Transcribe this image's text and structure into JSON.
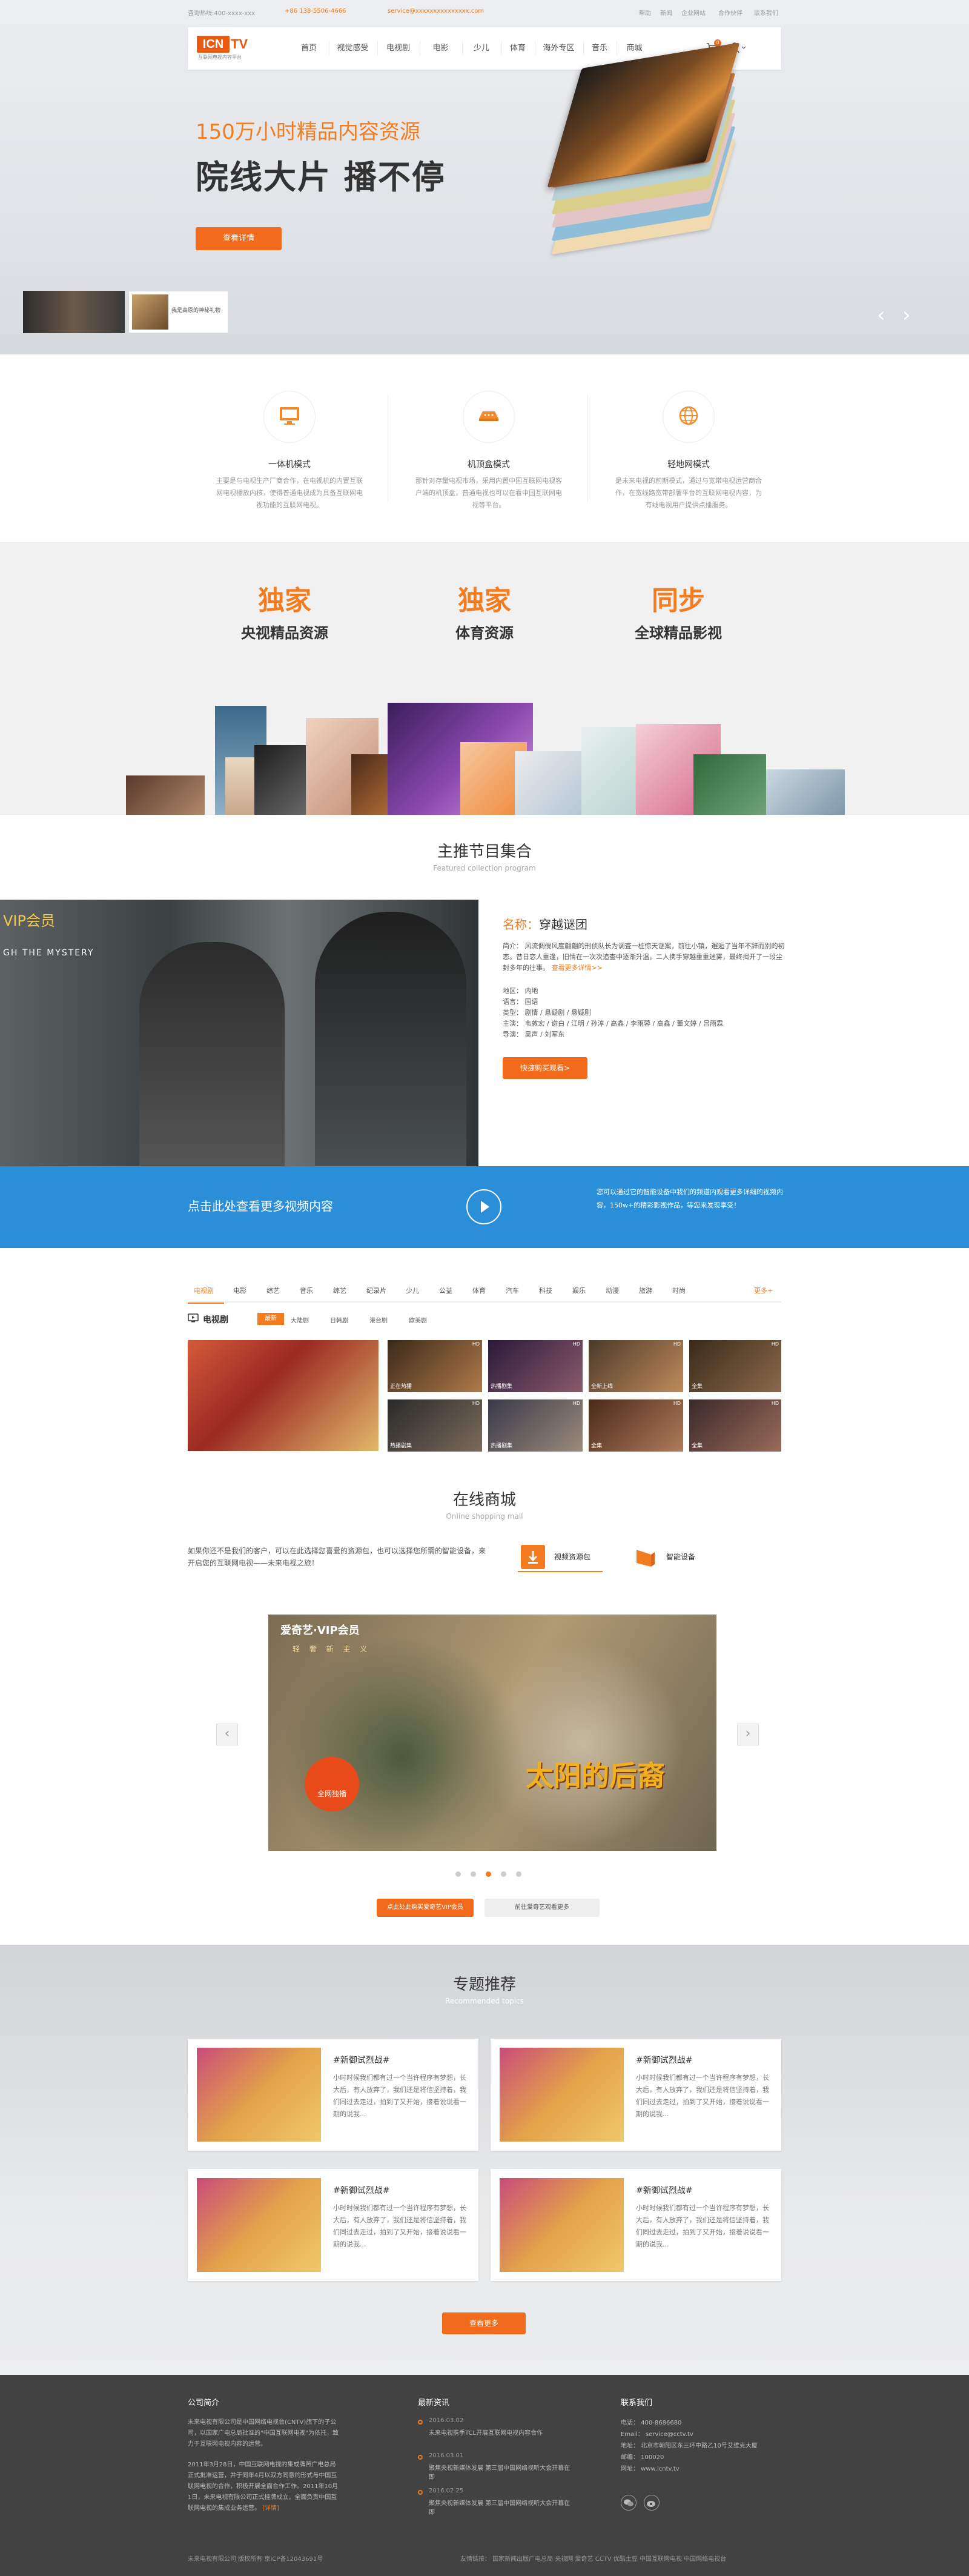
{
  "topbar": {
    "left": "咨询热线:400-xxxx-xxx",
    "phone": "+86 138-5506-4666",
    "email": "service@xxxxxxxxxxxxxxx.com",
    "links": [
      "帮助",
      "新闻",
      "企业网站",
      "合作伙伴",
      "联系我们"
    ]
  },
  "logo": {
    "mark": "ICN",
    "tv": "TV",
    "tagline": "互联网电视内容平台"
  },
  "nav": [
    "首页",
    "视觉感受",
    "电视剧",
    "电影",
    "少儿",
    "体育",
    "海外专区",
    "音乐",
    "商城"
  ],
  "cart_count": "0",
  "hero": {
    "subtitle_num": "150万",
    "subtitle": "小时精品内容资源",
    "title": "院线大片 播不停",
    "cta": "查看详情",
    "thumb_caption": "我是高原的神秘礼物"
  },
  "features": [
    {
      "icon": "monitor-icon",
      "title": "一体机模式",
      "desc": "主要是与电视生产厂商合作，在电视机的内置互联网电视播放内核，使得普通电视成为具备互联网电视功能的互联网电视。"
    },
    {
      "icon": "set-top-box-icon",
      "title": "机顶盒模式",
      "desc": "那针对存量电视市场，采用内置中国互联网电视客户端的机顶盒，普通电视也可以在看中国互联网电视等平台。"
    },
    {
      "icon": "globe-icon",
      "title": "轻地网模式",
      "desc": "是未来电视的前期模式，通过与宽带电视运营商合作，在宽线路宽带部署平台的互联网电视内容，为有线电视用户提供点播服务。"
    }
  ],
  "exclusive": [
    {
      "big": "独家",
      "small": "央视精品资源"
    },
    {
      "big": "独家",
      "small": "体育资源"
    },
    {
      "big": "同步",
      "small": "全球精品影视"
    }
  ],
  "featured": {
    "title": "主推节目集合",
    "subtitle": "Featured collection program",
    "vip": "VIP会员",
    "poster_en": "GH THE MYSTERY",
    "name_label": "名称：",
    "name": "穿越谜团",
    "intro": "简介：  风流倜傥风度翩翩的刑侦队长为调查一桩惊天谜案，前往小镇，邂逅了当年不辞而别的初恋。昔日恋人重逢，旧情在一次次追查中逐渐升温，二人携手穿越重重迷雾，最终揭开了一段尘封多年的往事。",
    "more": "查看更多详情>>",
    "meta": [
      "地区：  内地",
      "语言：  国语",
      "类型：  剧情 / 悬疑剧 / 悬疑剧",
      "主演：  韦敦宏 / 谢白 / 江明 / 孙淳 / 高鑫 / 李雨蓉 / 高鑫 / 董文婷 / 吕雨霖",
      "导演：  吴声 / 刘军东"
    ],
    "button": "快捷购买观看>"
  },
  "blue": {
    "left": "点击此处查看更多视频内容",
    "right": "您可以通过它的智能设备中我们的频道内观看更多详细的视频内容，150w+的精彩影视作品，等您来发现享受！"
  },
  "categories": [
    "电视剧",
    "电影",
    "综艺",
    "音乐",
    "综艺",
    "纪录片",
    "少儿",
    "公益",
    "体育",
    "汽车",
    "科技",
    "娱乐",
    "动漫",
    "旅游",
    "时尚",
    "更多+"
  ],
  "tv": {
    "label": "电视剧",
    "tabs": [
      "最新",
      "大陆剧",
      "日韩剧",
      "港台剧",
      "欧美剧"
    ]
  },
  "tv_grid": [
    {
      "caption": "",
      "tag": ""
    },
    {
      "caption": "正在热播",
      "tag": "HD"
    },
    {
      "caption": "热播剧集",
      "tag": "HD"
    },
    {
      "caption": "全新上线",
      "tag": "HD"
    },
    {
      "caption": "全集",
      "tag": "HD"
    },
    {
      "caption": "热播剧集",
      "tag": "HD"
    },
    {
      "caption": "热播剧集",
      "tag": "HD"
    },
    {
      "caption": "全集",
      "tag": "HD"
    },
    {
      "caption": "全集",
      "tag": "HD"
    }
  ],
  "store": {
    "title": "在线商城",
    "subtitle": "Online shopping mall",
    "text": "如果你还不是我们的客户，可以在此选择您喜爱的资源包，也可以选择您所需的智能设备，来开启您的互联网电视——未来电视之旅！",
    "tab1": "视频资源包",
    "tab2": "智能设备",
    "banner_brand": "爱奇艺·VIP会员",
    "banner_sub": "轻 奢 新 主 义",
    "banner_title": "太阳的后裔",
    "banner_badge": "全网独播",
    "btn1": "点此处此购买爱奇艺VIP会员",
    "btn2": "前往爱奇艺观看更多"
  },
  "topics": {
    "title": "专题推荐",
    "subtitle": "Recommended topics",
    "cards": [
      {
        "title": "#新御试烈战#",
        "text": "小时时候我们都有过一个当许程序有梦想，长大后，有人放弃了，我们还是将信坚持着，我们同过去走过，拍到了又开始，接着说说看一期的说我..."
      },
      {
        "title": "#新御试烈战#",
        "text": "小时时候我们都有过一个当许程序有梦想，长大后，有人放弃了，我们还是将信坚持着，我们同过去走过，拍到了又开始，接着说说看一期的说我..."
      },
      {
        "title": "#新御试烈战#",
        "text": "小时时候我们都有过一个当许程序有梦想，长大后，有人放弃了，我们还是将信坚持着，我们同过去走过，拍到了又开始，接着说说看一期的说我..."
      },
      {
        "title": "#新御试烈战#",
        "text": "小时时候我们都有过一个当许程序有梦想，长大后，有人放弃了，我们还是将信坚持着，我们同过去走过，拍到了又开始，接着说说看一期的说我..."
      }
    ],
    "more": "查看更多"
  },
  "footer": {
    "about_title": "公司简介",
    "about1": "未来电视有限公司是中国网络电视台(CNTV)旗下的子公司，以国家广电总局批准的\"中国互联网电视\"为依托，致力于互联网电视内容的运营。",
    "about2": "2011年3月28日，中国互联网电视的集成牌照广电总局正式批准运营，并于同年4月以双方同意的形式与中国互联网电视的合作，积极开展全面合作工作。2011年10月1日，未来电视有限公司正式挂牌成立，全面负责中国互联网电视的集成业务运营。",
    "about_more": "[详情]",
    "news_title": "最新资讯",
    "news": [
      {
        "date": "2016.03.02",
        "text": "未来电视携手TCL开展互联网电视内容合作"
      },
      {
        "date": "2016.03.01",
        "text": "聚焦央视新媒体发展 第三届中国网络视听大会开幕在即"
      },
      {
        "date": "2016.02.25",
        "text": "聚焦央视新媒体发展 第三届中国网络视听大会开幕在即"
      }
    ],
    "contact_title": "联系我们",
    "contact": [
      "电话：  400-8686680",
      "Email：  service@cctv.tv",
      "地址：  北京市朝阳区东三环中路乙10号艾维克大厦",
      "邮编：  100020",
      "网址：  www.icntv.tv"
    ],
    "copyright": "未来电视有限公司   版权所有   京ICP备12043691号",
    "links": "友情链接：  国家新闻出版广电总局   央视网   爱奇艺   CCTV   优酷土豆   中国互联网电视   中国网络电视台"
  }
}
